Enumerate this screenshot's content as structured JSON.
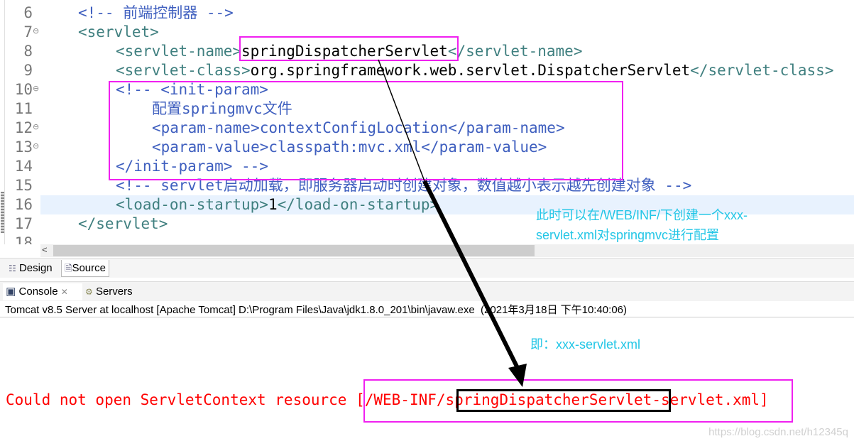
{
  "editor": {
    "lines": [
      {
        "n": "6",
        "fold": false,
        "indent": 110,
        "segs": [
          {
            "t": "<!-- 前端控制器 -->",
            "c": "cmt"
          }
        ]
      },
      {
        "n": "7",
        "fold": true,
        "indent": 110,
        "segs": [
          {
            "t": "<servlet>",
            "c": "tag"
          }
        ]
      },
      {
        "n": "8",
        "fold": false,
        "indent": 163,
        "segs": [
          {
            "t": "<servlet-name>",
            "c": "tag"
          },
          {
            "t": "springDispatcherServlet",
            "c": "txt"
          },
          {
            "t": "</servlet-name>",
            "c": "tag"
          }
        ]
      },
      {
        "n": "9",
        "fold": false,
        "indent": 163,
        "segs": [
          {
            "t": "<servlet-class>",
            "c": "tag"
          },
          {
            "t": "org.springframework.web.servlet.DispatcherServlet",
            "c": "txt"
          },
          {
            "t": "</servlet-class>",
            "c": "tag"
          }
        ]
      },
      {
        "n": "10",
        "fold": true,
        "indent": 163,
        "segs": [
          {
            "t": "<!-- <init-param>",
            "c": "cmt"
          }
        ]
      },
      {
        "n": "11",
        "fold": false,
        "indent": 214,
        "segs": [
          {
            "t": "配置springmvc文件",
            "c": "cmt"
          }
        ]
      },
      {
        "n": "12",
        "fold": true,
        "indent": 214,
        "segs": [
          {
            "t": "<param-name>contextConfigLocation</param-name>",
            "c": "cmt"
          }
        ]
      },
      {
        "n": "13",
        "fold": true,
        "indent": 214,
        "segs": [
          {
            "t": "<param-value>classpath:mvc.xml</param-value>",
            "c": "cmt"
          }
        ]
      },
      {
        "n": "14",
        "fold": false,
        "indent": 163,
        "segs": [
          {
            "t": "</init-param> -->",
            "c": "cmt"
          }
        ]
      },
      {
        "n": "15",
        "fold": false,
        "indent": 163,
        "segs": [
          {
            "t": "<!-- servlet启动加载，即服务器启动时创建对象，数值越小表示越先创建对象 -->",
            "c": "cmt"
          }
        ]
      },
      {
        "n": "16",
        "fold": false,
        "indent": 163,
        "current": true,
        "segs": [
          {
            "t": "<load-on-startup>",
            "c": "tag"
          },
          {
            "t": "1",
            "c": "txt"
          },
          {
            "t": "</load-on-startup>",
            "c": "tag"
          }
        ]
      },
      {
        "n": "17",
        "fold": false,
        "indent": 110,
        "segs": [
          {
            "t": "</servlet>",
            "c": "tag"
          }
        ]
      },
      {
        "n": "18",
        "fold": false,
        "indent": 110,
        "segs": []
      }
    ]
  },
  "editor_tabs": {
    "design": "Design",
    "source": "Source"
  },
  "console": {
    "tabs": {
      "console": "Console",
      "servers": "Servers"
    },
    "description": "Tomcat v8.5 Server at localhost [Apache Tomcat] D:\\Program Files\\Java\\jdk1.8.0_201\\bin\\javaw.exe  (2021年3月18日 下午10:40:06)",
    "error_prefix": "Could not open ServletContext resource ",
    "error_path_start": "[/WEB-INF/",
    "error_name": "springDispatcherServlet",
    "error_path_end": "-servlet.xml]"
  },
  "annotations": {
    "note1_line1": "此时可以在/WEB/INF/下创建一个xxx-",
    "note1_line2": "servlet.xml对springmvc进行配置",
    "note2": "即：xxx-servlet.xml"
  },
  "watermark": "https://blog.csdn.net/h12345q",
  "colors": {
    "tag": "#3f7f7f",
    "comment": "#3f5fbf",
    "error": "#ff0000",
    "highlight_box": "#f020f0",
    "annotation": "#22c6e6"
  }
}
